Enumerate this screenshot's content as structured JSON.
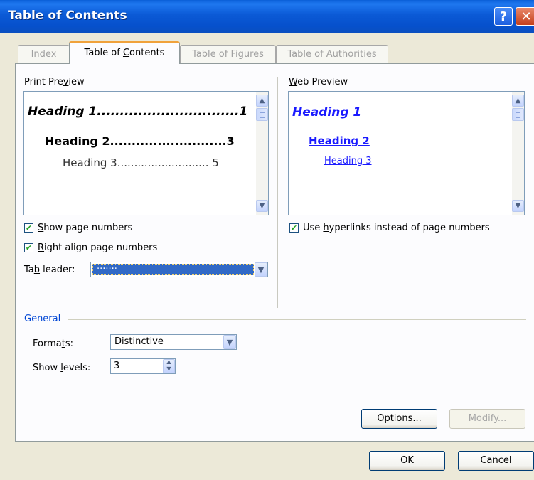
{
  "window": {
    "title": "Table of Contents",
    "help_glyph": "?",
    "close_glyph": "✕"
  },
  "tabs": [
    {
      "label": "Index",
      "active": false
    },
    {
      "label": "Table of Contents",
      "active": true
    },
    {
      "label": "Table of Figures",
      "active": false
    },
    {
      "label": "Table of Authorities",
      "active": false
    }
  ],
  "print_preview": {
    "label": "Print Preview",
    "h1": "Heading 1...............................1",
    "h2": "Heading 2...........................3",
    "h3": "Heading 3........................... 5"
  },
  "web_preview": {
    "label": "Web Preview",
    "h1": "Heading 1",
    "h2": "Heading 2",
    "h3": "Heading 3"
  },
  "options": {
    "show_page_numbers": {
      "label": "Show page numbers",
      "checked": true
    },
    "right_align": {
      "label": "Right align page numbers",
      "checked": true
    },
    "use_hyperlinks": {
      "label": "Use hyperlinks instead of page numbers",
      "checked": true
    },
    "tab_leader": {
      "label": "Tab leader:",
      "value": "......."
    }
  },
  "general": {
    "section_label": "General",
    "formats_label": "Formats:",
    "formats_value": "Distinctive",
    "levels_label": "Show levels:",
    "levels_value": "3"
  },
  "buttons": {
    "options": "Options...",
    "modify": "Modify...",
    "ok": "OK",
    "cancel": "Cancel"
  },
  "icons": {
    "scroll_up": "▲",
    "scroll_down": "▼",
    "dropdown": "▼"
  },
  "colors": {
    "titlebar": "#0b5ad6",
    "link": "#1a1aff",
    "selection": "#3169c6",
    "section": "#0046d5"
  }
}
